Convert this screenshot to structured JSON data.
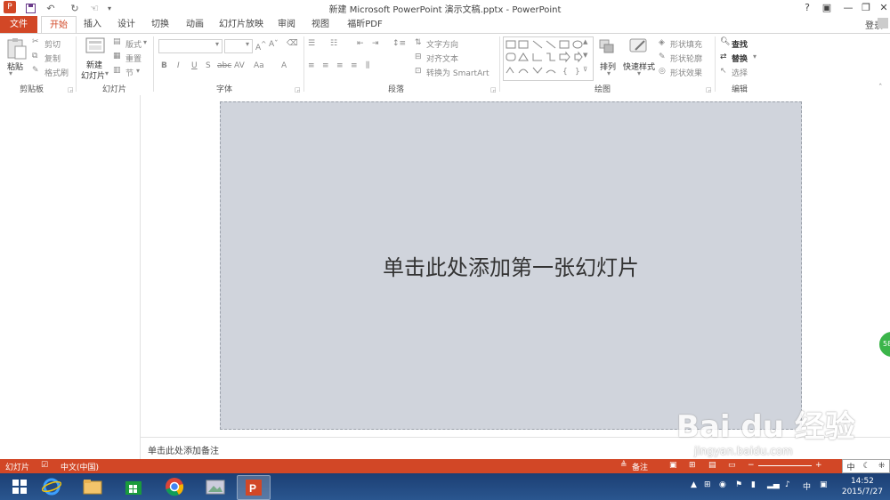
{
  "window": {
    "title": "新建 Microsoft PowerPoint 演示文稿.pptx - PowerPoint",
    "help": "?",
    "controls": [
      "▣",
      "—",
      "❐",
      "✕"
    ]
  },
  "tabs": [
    {
      "label": "文件"
    },
    {
      "label": "开始"
    },
    {
      "label": "插入"
    },
    {
      "label": "设计"
    },
    {
      "label": "切换"
    },
    {
      "label": "动画"
    },
    {
      "label": "幻灯片放映"
    },
    {
      "label": "审阅"
    },
    {
      "label": "视图"
    },
    {
      "label": "福昕PDF"
    }
  ],
  "signin": "登录",
  "ribbon": {
    "clipboard": {
      "label": "剪贴板",
      "paste": "粘贴",
      "cut": "剪切",
      "copy": "复制",
      "format_painter": "格式刷"
    },
    "slides": {
      "label": "幻灯片",
      "new_slide": "新建",
      "new_slide2": "幻灯片",
      "layout": "版式",
      "reset": "重置",
      "section": "节"
    },
    "font": {
      "label": "字体"
    },
    "paragraph": {
      "label": "段落",
      "text_direction": "文字方向",
      "align_text": "对齐文本",
      "smartart": "转换为 SmartArt"
    },
    "drawing": {
      "label": "绘图",
      "arrange": "排列",
      "quick_styles": "快速样式",
      "shape_fill": "形状填充",
      "shape_outline": "形状轮廓",
      "shape_effects": "形状效果"
    },
    "editing": {
      "label": "编辑",
      "find": "查找",
      "replace": "替换",
      "select": "选择"
    }
  },
  "slide": {
    "placeholder": "单击此处添加第一张幻灯片"
  },
  "notes": {
    "placeholder": "单击此处添加备注"
  },
  "status": {
    "slide": "幻灯片",
    "language": "中文(中国)",
    "notes": "备注"
  },
  "taskbar": {
    "apps": [
      "start",
      "ie",
      "explorer",
      "store",
      "chrome",
      "photos",
      "powerpoint"
    ],
    "clock_time": "14:52",
    "clock_date": "2015/7/27",
    "ime": "中"
  },
  "overlay": {
    "floater_text": "58",
    "watermark": "Bai du 经验",
    "watermark_url": "jingyan.baidu.com"
  }
}
